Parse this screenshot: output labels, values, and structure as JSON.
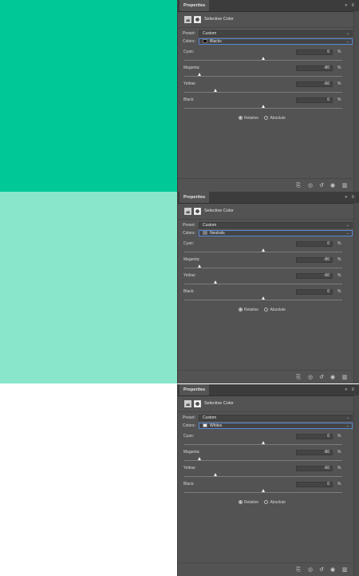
{
  "swatches": [
    {
      "color": "#00c896"
    },
    {
      "color": "#8ae6cb"
    },
    {
      "color": "#ffffff"
    }
  ],
  "panels": [
    {
      "tab": "Properties",
      "expand_icon": "»",
      "menu_icon": "≡",
      "title": "Selective Color",
      "preset_label": "Preset:",
      "preset_value": "Custom",
      "colors_label": "Colors:",
      "colors_value": "Blacks",
      "colors_chip": "#000000",
      "cyan_label": "Cyan:",
      "cyan_value": "0",
      "cyan_pct": "%",
      "cyan_level": 0,
      "magenta_label": "Magenta:",
      "magenta_value": "-80",
      "magenta_pct": "%",
      "magenta_level": -80,
      "yellow_label": "Yellow:",
      "yellow_value": "-60",
      "yellow_pct": "%",
      "yellow_level": -60,
      "black_label": "Black:",
      "black_value": "0",
      "black_pct": "%",
      "black_level": 0,
      "relative_label": "Relative",
      "absolute_label": "Absolute",
      "method_selected": "Relative"
    },
    {
      "tab": "Properties",
      "expand_icon": "»",
      "menu_icon": "≡",
      "title": "Selective Color",
      "preset_label": "Preset:",
      "preset_value": "Custom",
      "colors_label": "Colors:",
      "colors_value": "Neutrals",
      "colors_chip": "#808080",
      "cyan_label": "Cyan:",
      "cyan_value": "0",
      "cyan_pct": "%",
      "cyan_level": 0,
      "magenta_label": "Magenta:",
      "magenta_value": "-80",
      "magenta_pct": "%",
      "magenta_level": -80,
      "yellow_label": "Yellow:",
      "yellow_value": "-60",
      "yellow_pct": "%",
      "yellow_level": -60,
      "black_label": "Black:",
      "black_value": "0",
      "black_pct": "%",
      "black_level": 0,
      "relative_label": "Relative",
      "absolute_label": "Absolute",
      "method_selected": "Relative"
    },
    {
      "tab": "Properties",
      "expand_icon": "»",
      "menu_icon": "≡",
      "title": "Selective Color",
      "preset_label": "Preset:",
      "preset_value": "Custom",
      "colors_label": "Colors:",
      "colors_value": "Whites",
      "colors_chip": "#ffffff",
      "cyan_label": "Cyan:",
      "cyan_value": "0",
      "cyan_pct": "%",
      "cyan_level": 0,
      "magenta_label": "Magenta:",
      "magenta_value": "-80",
      "magenta_pct": "%",
      "magenta_level": -80,
      "yellow_label": "Yellow:",
      "yellow_value": "-60",
      "yellow_pct": "%",
      "yellow_level": -60,
      "black_label": "Black:",
      "black_value": "0",
      "black_pct": "%",
      "black_level": 0,
      "relative_label": "Relative",
      "absolute_label": "Absolute",
      "method_selected": "Relative"
    }
  ],
  "footer_icons": [
    "clip-to-layer-icon",
    "view-previous-state-icon",
    "reset-icon",
    "visibility-eye-icon",
    "trash-icon"
  ]
}
